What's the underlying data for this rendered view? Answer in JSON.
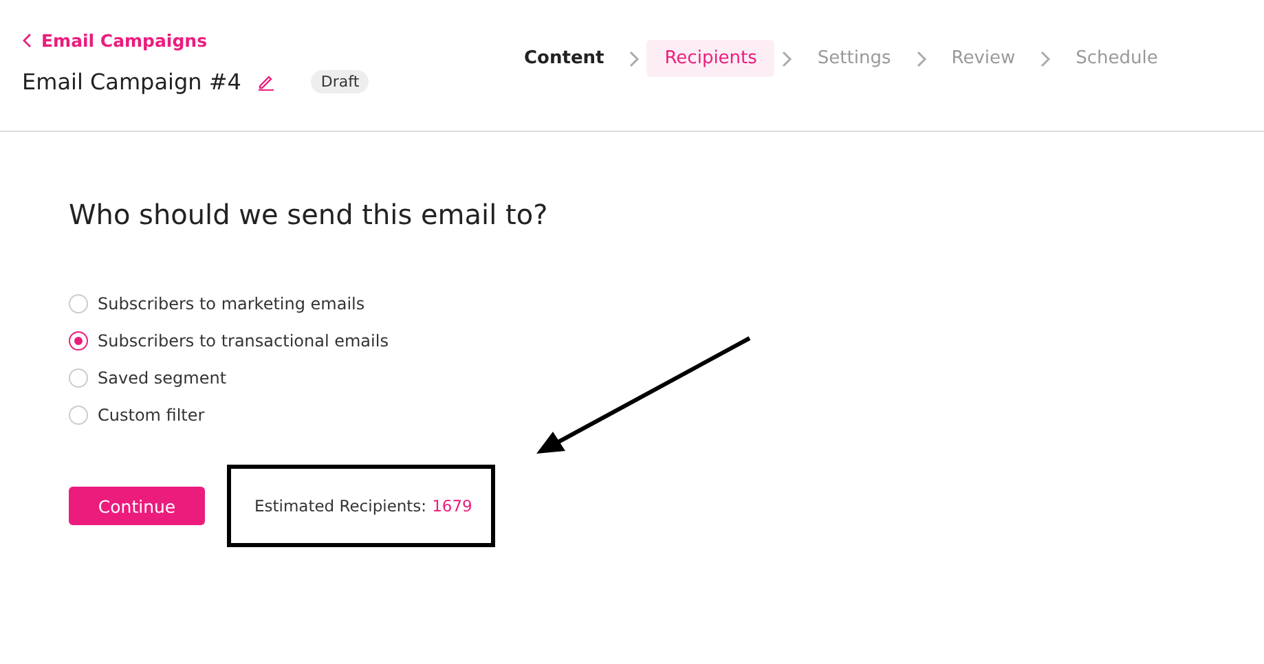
{
  "back_link": {
    "label": "Email Campaigns"
  },
  "campaign": {
    "title": "Email Campaign #4",
    "status": "Draft"
  },
  "steps": [
    {
      "label": "Content",
      "completed": true,
      "selected": false
    },
    {
      "label": "Recipients",
      "completed": false,
      "selected": true
    },
    {
      "label": "Settings",
      "completed": false,
      "selected": false
    },
    {
      "label": "Review",
      "completed": false,
      "selected": false
    },
    {
      "label": "Schedule",
      "completed": false,
      "selected": false
    }
  ],
  "question": "Who should we send this email to?",
  "options": [
    {
      "label": "Subscribers to marketing emails",
      "selected": false
    },
    {
      "label": "Subscribers to transactional emails",
      "selected": true
    },
    {
      "label": "Saved segment",
      "selected": false
    },
    {
      "label": "Custom filter",
      "selected": false
    }
  ],
  "continue_button": "Continue",
  "estimate": {
    "label": "Estimated Recipients:",
    "count": "1679",
    "highlighted": true
  }
}
